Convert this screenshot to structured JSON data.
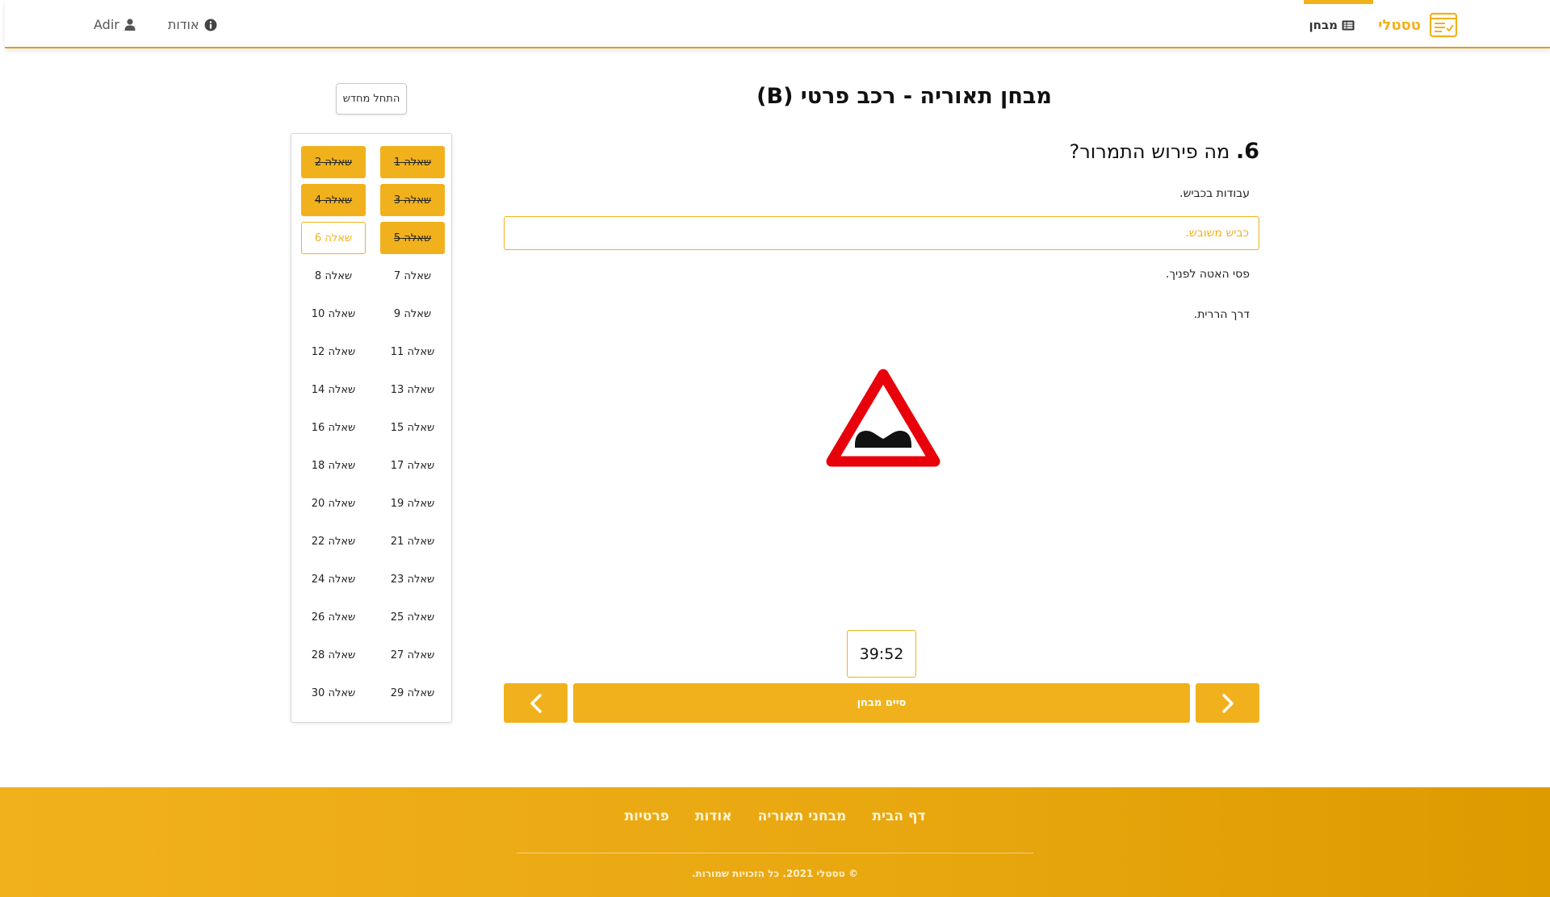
{
  "header": {
    "brand": "טסטלי",
    "nav_exam": "מבחן",
    "nav_about": "אודות",
    "user_name": "Adir"
  },
  "main": {
    "title": "מבחן תאוריה - רכב פרטי (B)",
    "restart_label": "התחל מחדש",
    "question_number": "6.",
    "question_text": "מה פירוש התמרור?",
    "answers": [
      "עבודות בכביש.",
      "כביש משובש.",
      "פסי האטה לפניך.",
      "דרך הררית."
    ],
    "selected_answer_index": 1,
    "timer": "39:52",
    "finish_label": "סיים מבחן"
  },
  "questions": [
    {
      "label": "שאלה 1",
      "state": "done"
    },
    {
      "label": "שאלה 2",
      "state": "done"
    },
    {
      "label": "שאלה 3",
      "state": "done"
    },
    {
      "label": "שאלה 4",
      "state": "done"
    },
    {
      "label": "שאלה 5",
      "state": "done"
    },
    {
      "label": "שאלה 6",
      "state": "current"
    },
    {
      "label": "שאלה 7",
      "state": "open"
    },
    {
      "label": "שאלה 8",
      "state": "open"
    },
    {
      "label": "שאלה 9",
      "state": "open"
    },
    {
      "label": "שאלה 10",
      "state": "open"
    },
    {
      "label": "שאלה 11",
      "state": "open"
    },
    {
      "label": "שאלה 12",
      "state": "open"
    },
    {
      "label": "שאלה 13",
      "state": "open"
    },
    {
      "label": "שאלה 14",
      "state": "open"
    },
    {
      "label": "שאלה 15",
      "state": "open"
    },
    {
      "label": "שאלה 16",
      "state": "open"
    },
    {
      "label": "שאלה 17",
      "state": "open"
    },
    {
      "label": "שאלה 18",
      "state": "open"
    },
    {
      "label": "שאלה 19",
      "state": "open"
    },
    {
      "label": "שאלה 20",
      "state": "open"
    },
    {
      "label": "שאלה 21",
      "state": "open"
    },
    {
      "label": "שאלה 22",
      "state": "open"
    },
    {
      "label": "שאלה 23",
      "state": "open"
    },
    {
      "label": "שאלה 24",
      "state": "open"
    },
    {
      "label": "שאלה 25",
      "state": "open"
    },
    {
      "label": "שאלה 26",
      "state": "open"
    },
    {
      "label": "שאלה 27",
      "state": "open"
    },
    {
      "label": "שאלה 28",
      "state": "open"
    },
    {
      "label": "שאלה 29",
      "state": "open"
    },
    {
      "label": "שאלה 30",
      "state": "open"
    }
  ],
  "footer": {
    "links": [
      "דף הבית",
      "מבחני תאוריה",
      "אודות",
      "פרטיות"
    ],
    "copyright": "© טסטלי 2021. כל הזכויות שמורות."
  },
  "colors": {
    "accent": "#f1b11d",
    "sign_red": "#e8000b"
  },
  "icons": {
    "brand": "checklist-icon",
    "exam": "list-icon",
    "about": "info-circle-icon",
    "user": "user-icon",
    "next": "chevron-right-icon",
    "prev": "chevron-left-icon"
  }
}
